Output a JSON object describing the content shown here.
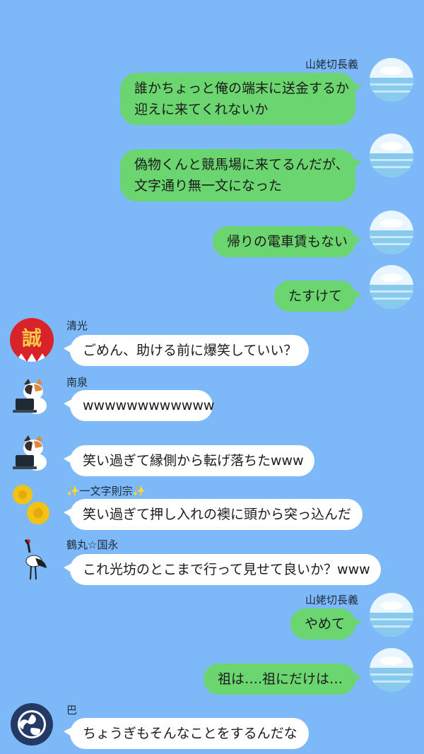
{
  "conversation": {
    "messages": [
      {
        "sender": "山姥切長義",
        "side": "right",
        "show_name": true,
        "avatar": "sky-sea-icon",
        "lines": [
          "誰かちょっと俺の端末に送金するか",
          "迎えに来てくれないか"
        ]
      },
      {
        "sender": "山姥切長義",
        "side": "right",
        "show_name": false,
        "avatar": "sky-sea-icon",
        "lines": [
          "偽物くんと競馬場に来てるんだが、",
          "文字通り無一文になった"
        ]
      },
      {
        "sender": "山姥切長義",
        "side": "right",
        "show_name": false,
        "avatar": "sky-sea-icon",
        "lines": [
          "帰りの電車賃もない"
        ]
      },
      {
        "sender": "山姥切長義",
        "side": "right",
        "show_name": false,
        "avatar": "sky-sea-icon",
        "lines": [
          "たすけて"
        ]
      },
      {
        "sender": "清光",
        "side": "left",
        "show_name": true,
        "avatar": "makoto-emblem-icon",
        "lines": [
          "ごめん、助ける前に爆笑していい？"
        ]
      },
      {
        "sender": "南泉",
        "side": "left",
        "show_name": true,
        "avatar": "calico-cat-laptop-icon",
        "lines": [
          "wwwwwwwwwwww"
        ]
      },
      {
        "sender": "南泉",
        "side": "left",
        "show_name": false,
        "avatar": "calico-cat-laptop-icon",
        "lines": [
          "笑い過ぎて縁側から転げ落ちたwww"
        ]
      },
      {
        "sender": "✨一文字則宗✨",
        "side": "left",
        "show_name": true,
        "avatar": "chrysanthemum-icon",
        "lines": [
          "笑い過ぎて押し入れの襖に頭から突っ込んだ"
        ]
      },
      {
        "sender": "鶴丸☆国永",
        "side": "left",
        "show_name": true,
        "avatar": "crane-bird-icon",
        "lines": [
          "これ光坊のとこまで行って見せて良いか？www"
        ]
      },
      {
        "sender": "山姥切長義",
        "side": "right",
        "show_name": true,
        "avatar": "sky-sea-icon",
        "lines": [
          "やめて"
        ]
      },
      {
        "sender": "山姥切長義",
        "side": "right",
        "show_name": false,
        "avatar": "sky-sea-icon",
        "lines": [
          "祖は….祖にだけは…"
        ]
      },
      {
        "sender": "巴",
        "side": "left",
        "show_name": true,
        "avatar": "tomoe-crest-icon",
        "lines": [
          "ちょうぎもそんなことをするんだな"
        ]
      }
    ]
  },
  "colors": {
    "background": "#7db9f8",
    "own_bubble": "#6bd56f",
    "other_bubble": "#ffffff",
    "text": "#1b1b1b"
  }
}
